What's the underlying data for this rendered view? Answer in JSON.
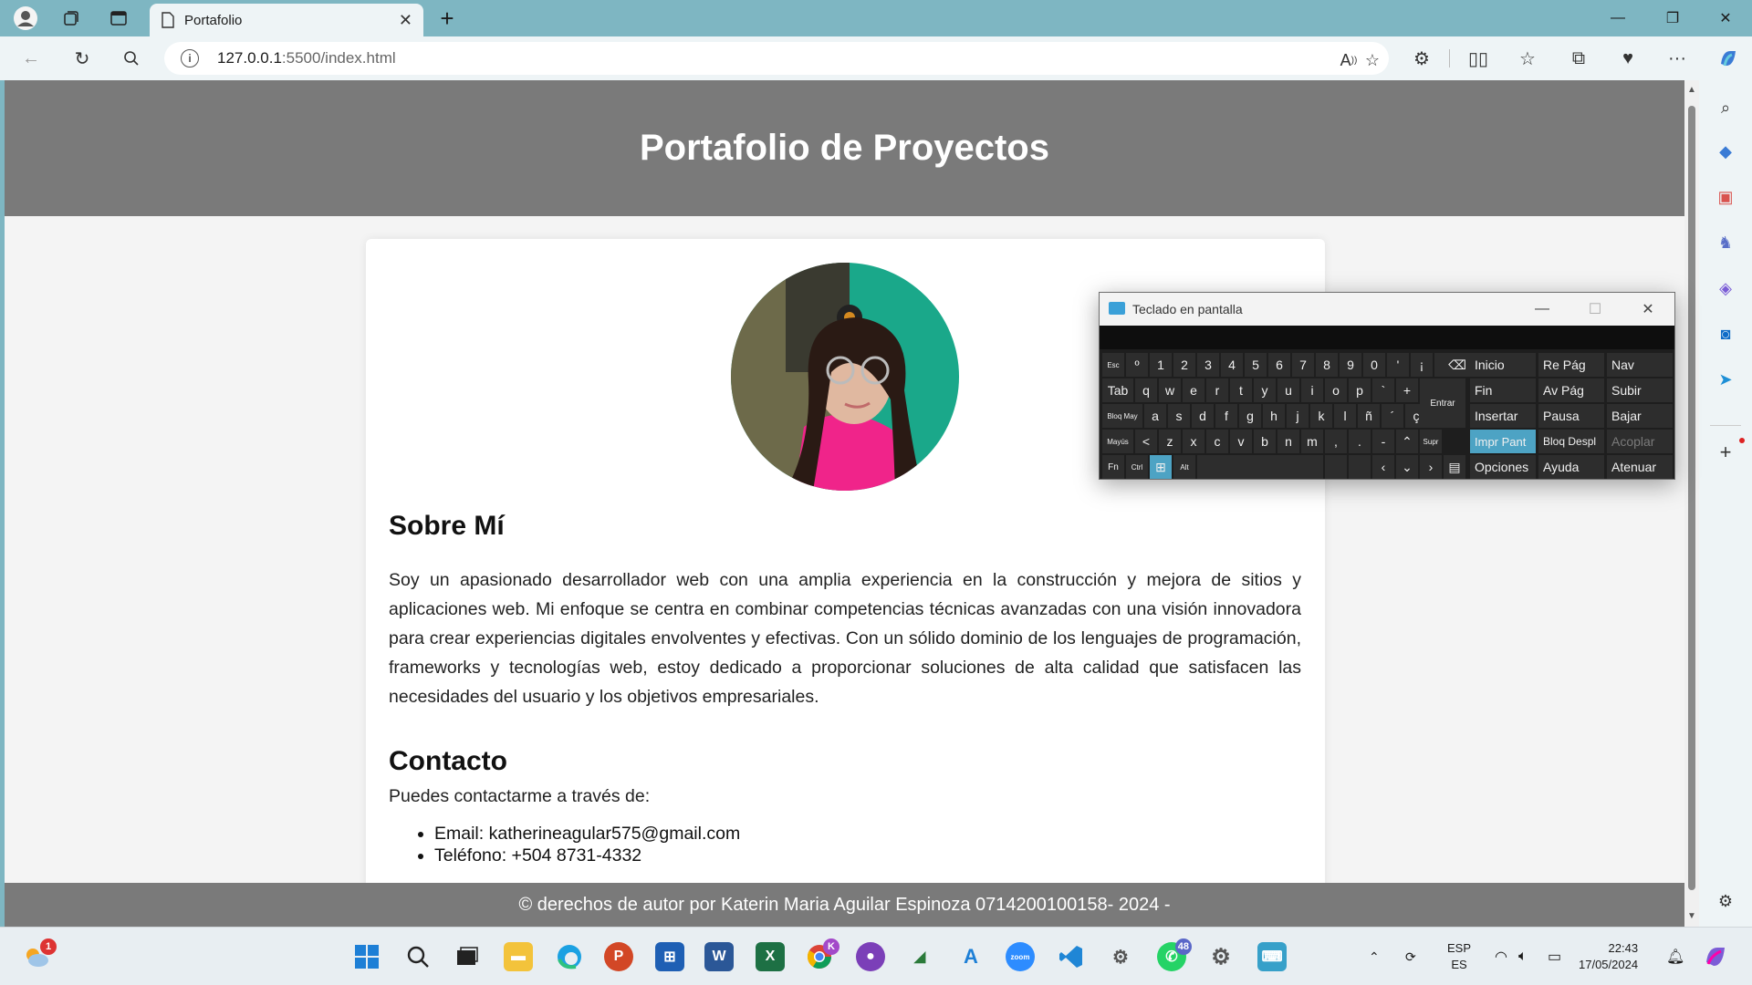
{
  "browser": {
    "tab_title": "Portafolio",
    "url_host": "127.0.0.1",
    "url_rest": ":5500/index.html"
  },
  "page": {
    "header_title": "Portafolio de Proyectos",
    "about_heading": "Sobre Mí",
    "about_text": "Soy un apasionado desarrollador web con una amplia experiencia en la construcción y mejora de sitios y aplicaciones web. Mi enfoque se centra en combinar competencias técnicas avanzadas con una visión innovadora para crear experiencias digitales envolventes y efectivas. Con un sólido dominio de los lenguajes de programación, frameworks y tecnologías web, estoy dedicado a proporcionar soluciones de alta calidad que satisfacen las necesidades del usuario y los objetivos empresariales.",
    "contact_heading": "Contacto",
    "contact_intro": "Puedes contactarme a través de:",
    "contact_email": "Email: katherineagular575@gmail.com",
    "contact_phone": "Teléfono: +504 8731-4332",
    "footer": "© derechos de autor por Katerin Maria Aguilar Espinoza 0714200100158- 2024 -"
  },
  "osk": {
    "title": "Teclado en pantalla",
    "nav_keys": {
      "inicio": "Inicio",
      "repag": "Re Pág",
      "nav": "Nav",
      "fin": "Fin",
      "avpag": "Av Pág",
      "subir": "Subir",
      "insertar": "Insertar",
      "pausa": "Pausa",
      "bajar": "Bajar",
      "imprpant": "Impr Pant",
      "bloqdespl": "Bloq Despl",
      "acoplar": "Acoplar",
      "opciones": "Opciones",
      "ayuda": "Ayuda",
      "atenuar": "Atenuar"
    },
    "row1": [
      "º",
      "1",
      "2",
      "3",
      "4",
      "5",
      "6",
      "7",
      "8",
      "9",
      "0",
      "'",
      "¡"
    ],
    "row2": [
      "q",
      "w",
      "e",
      "r",
      "t",
      "y",
      "u",
      "i",
      "o",
      "p",
      "`",
      "+"
    ],
    "row3": [
      "a",
      "s",
      "d",
      "f",
      "g",
      "h",
      "j",
      "k",
      "l",
      "ñ",
      "´",
      "ç"
    ],
    "row4": [
      "<",
      "z",
      "x",
      "c",
      "v",
      "b",
      "n",
      "m",
      ",",
      ".",
      "-"
    ],
    "esc": "Esc",
    "tab": "Tab",
    "bloqmay": "Bloq May",
    "mayus": "Mayús",
    "fn": "Fn",
    "ctrl": "Ctrl",
    "alt": "Alt",
    "entrar": "Entrar",
    "supr": "Supr"
  },
  "taskbar": {
    "weather_badge": "1",
    "chrome_badge": "K",
    "whatsapp_badge": "48",
    "lang_top": "ESP",
    "lang_bottom": "ES",
    "time": "22:43",
    "date": "17/05/2024",
    "zoom_label": "zoom"
  },
  "colors": {
    "header_bg": "#7a7a7a",
    "accent_key": "#4da3c4",
    "tabstrip": "#7eb6c2"
  }
}
